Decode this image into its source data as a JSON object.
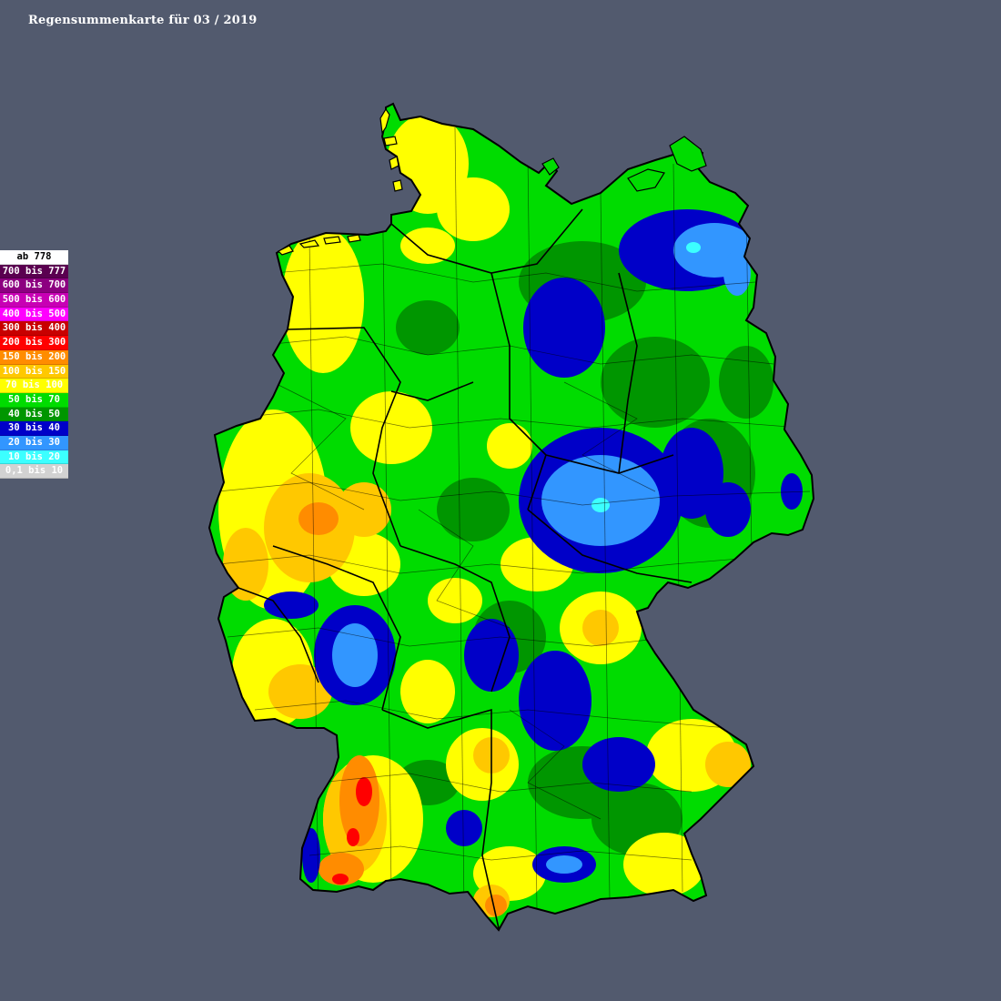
{
  "title": "Regensummenkarte für 03 / 2019",
  "legend": [
    {
      "label": "ab 778",
      "bg": "#ffffff",
      "fg": "#000000"
    },
    {
      "label": "700 bis 777",
      "bg": "#5a0050",
      "fg": "#ffffff"
    },
    {
      "label": "600 bis 700",
      "bg": "#8c0080",
      "fg": "#ffffff"
    },
    {
      "label": "500 bis 600",
      "bg": "#c800b4",
      "fg": "#ffffff"
    },
    {
      "label": "400 bis 500",
      "bg": "#ff00ff",
      "fg": "#ffffff"
    },
    {
      "label": "300 bis 400",
      "bg": "#c80000",
      "fg": "#ffffff"
    },
    {
      "label": "200 bis 300",
      "bg": "#ff0000",
      "fg": "#ffffff"
    },
    {
      "label": "150 bis 200",
      "bg": "#ff8c00",
      "fg": "#ffffff"
    },
    {
      "label": "100 bis 150",
      "bg": "#ffc800",
      "fg": "#ffffff"
    },
    {
      "label": "70 bis 100",
      "bg": "#ffff00",
      "fg": "#ffffff"
    },
    {
      "label": "50 bis 70",
      "bg": "#00dc00",
      "fg": "#ffffff"
    },
    {
      "label": "40 bis 50",
      "bg": "#009600",
      "fg": "#ffffff"
    },
    {
      "label": "30 bis 40",
      "bg": "#0000c8",
      "fg": "#ffffff"
    },
    {
      "label": "20 bis 30",
      "bg": "#3296ff",
      "fg": "#ffffff"
    },
    {
      "label": "10 bis 20",
      "bg": "#3cffff",
      "fg": "#ffffff"
    },
    {
      "label": "0,1 bis 10",
      "bg": "#d2d2d2",
      "fg": "#ffffff"
    }
  ]
}
